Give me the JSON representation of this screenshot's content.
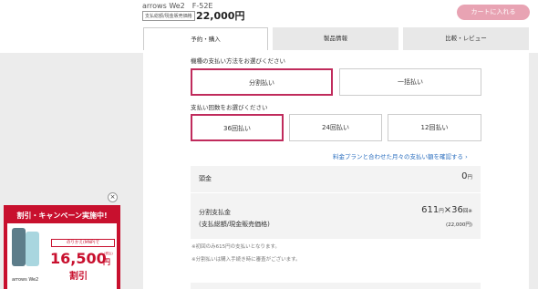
{
  "header": {
    "product_name": "arrows We2　F-52E",
    "price_tag": "支払総額/現金販売価格",
    "price": "22,000円",
    "cart_button": "カートに入れる"
  },
  "tabs": [
    {
      "label": "予約・購入",
      "active": true
    },
    {
      "label": "製品情報",
      "active": false
    },
    {
      "label": "比較・レビュー",
      "active": false
    }
  ],
  "payment_method": {
    "label": "機種の支払い方法をお選びください",
    "options": [
      {
        "label": "分割払い",
        "selected": true
      },
      {
        "label": "一括払い",
        "selected": false
      }
    ]
  },
  "installments": {
    "label": "支払い回数をお選びください",
    "options": [
      {
        "label": "36回払い",
        "selected": true
      },
      {
        "label": "24回払い",
        "selected": false
      },
      {
        "label": "12回払い",
        "selected": false
      }
    ]
  },
  "plan_link": "料金プランと合わせた月々の支払い額を確認する",
  "summary": {
    "down_label": "頭金",
    "down_value": "0",
    "down_unit": "円",
    "inst_label": "分割支払金",
    "inst_sub": "(支払総額/現金販売価格)",
    "inst_value": "611",
    "inst_unit": "円",
    "inst_times": "×36",
    "inst_times_unit": "回",
    "inst_mark": "※",
    "inst_total": "(22,000円)"
  },
  "notes": [
    "※初回のみ615円の支払いとなります。",
    "※分割払いは購入手続き時に審査がございます。"
  ],
  "banner": {
    "title": "割引・キャンペーン実施中!",
    "mnp": "のりかえ(MNP)で",
    "amount": "16,500",
    "yen": "円",
    "tax": "(税込)",
    "label": "割引",
    "phone_name": "arrows We2"
  },
  "colors": {
    "accent": "#c02b5c",
    "cart": "#e8a3b3",
    "banner": "#c8102e",
    "link": "#2c6fbf"
  }
}
